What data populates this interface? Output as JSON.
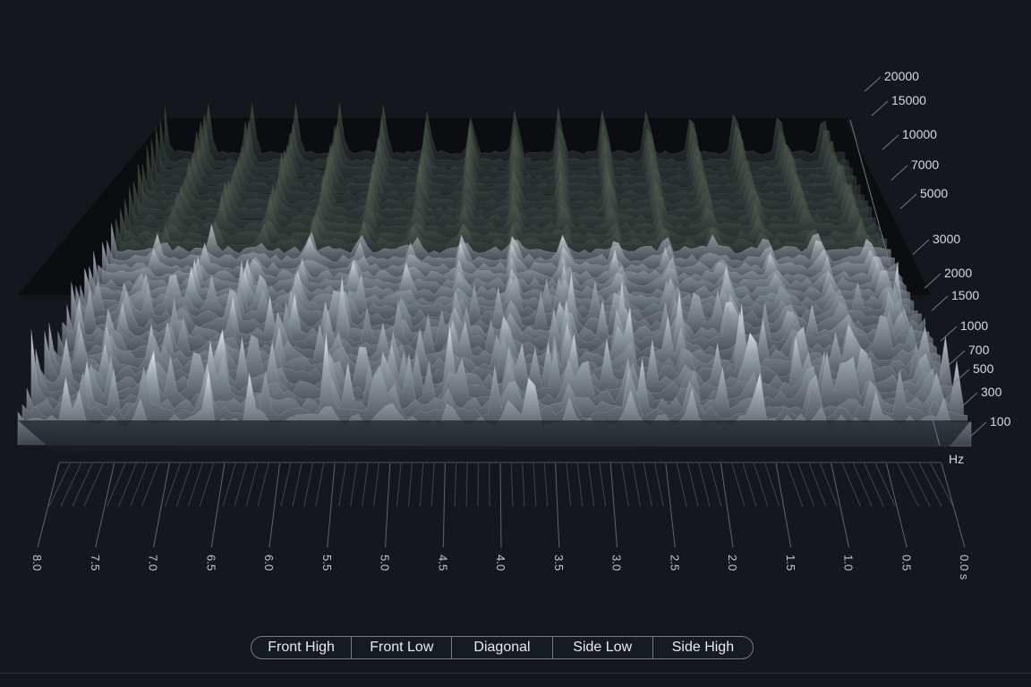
{
  "visualization": {
    "frequency_axis": {
      "ticks": [
        "20000",
        "15000",
        "10000",
        "7000",
        "5000",
        "3000",
        "2000",
        "1500",
        "1000",
        "700",
        "500",
        "300",
        "100"
      ],
      "unit": "Hz"
    },
    "time_axis": {
      "ticks": [
        "8.0",
        "7.5",
        "7.0",
        "6.5",
        "6.0",
        "5.5",
        "5.0",
        "4.5",
        "4.0",
        "3.5",
        "3.0",
        "2.5",
        "2.0",
        "1.5",
        "1.0",
        "0.5",
        "0.0 s"
      ]
    },
    "colors": {
      "background": "#14181d",
      "surface_low": "#3a4048",
      "surface_high": "#e6eaee",
      "axis": "#6f7a84"
    }
  },
  "view_modes": {
    "buttons": [
      "Front High",
      "Front Low",
      "Diagonal",
      "Side Low",
      "Side High"
    ]
  }
}
